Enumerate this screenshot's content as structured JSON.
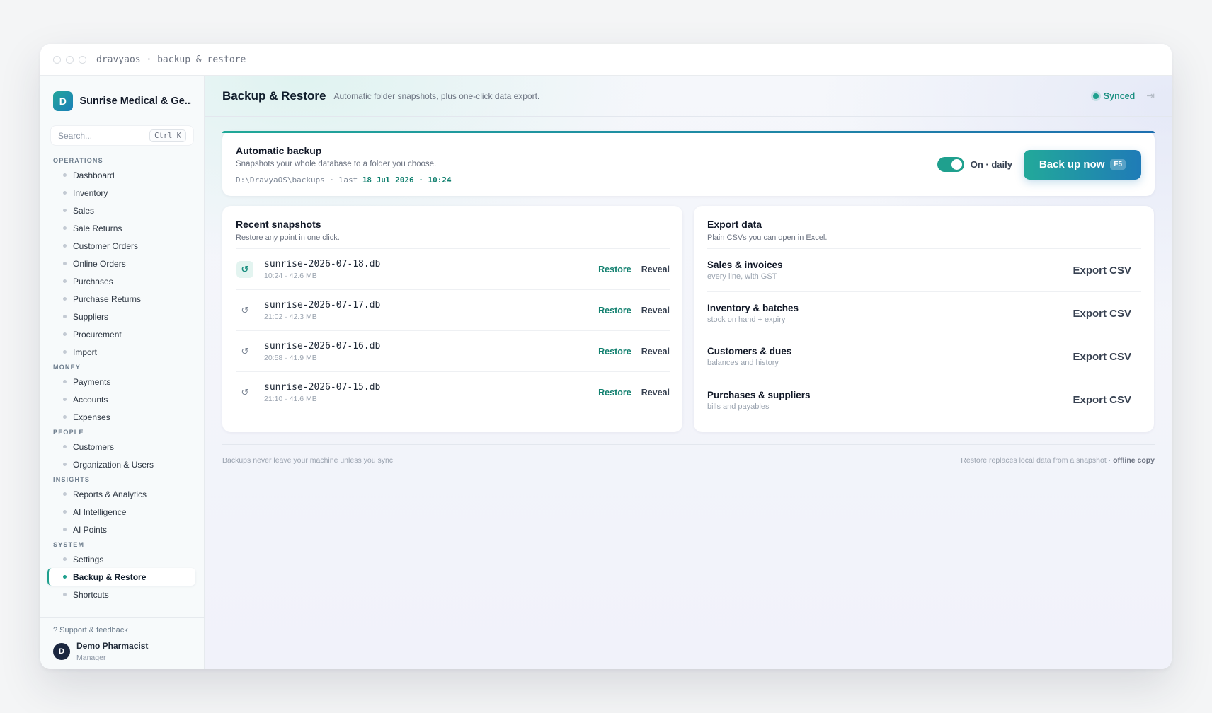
{
  "window": {
    "title": "dravyaos · backup & restore"
  },
  "sidebar": {
    "org_initial": "D",
    "org_name": "Sunrise Medical & Ge...",
    "search_placeholder": "Search...",
    "search_shortcut": "Ctrl K",
    "sections": [
      {
        "label": "OPERATIONS",
        "items": [
          "Dashboard",
          "Inventory",
          "Sales",
          "Sale Returns",
          "Customer Orders",
          "Online Orders",
          "Purchases",
          "Purchase Returns",
          "Suppliers",
          "Procurement",
          "Import"
        ]
      },
      {
        "label": "MONEY",
        "items": [
          "Payments",
          "Accounts",
          "Expenses"
        ]
      },
      {
        "label": "PEOPLE",
        "items": [
          "Customers",
          "Organization & Users"
        ]
      },
      {
        "label": "INSIGHTS",
        "items": [
          "Reports & Analytics",
          "AI Intelligence",
          "AI Points"
        ]
      },
      {
        "label": "SYSTEM",
        "items": [
          "Settings",
          "Backup & Restore",
          "Shortcuts"
        ]
      }
    ],
    "active_item": "Backup & Restore",
    "support": "? Support & feedback",
    "user_initial": "D",
    "user_name": "Demo Pharmacist",
    "user_role": "Manager"
  },
  "header": {
    "title": "Backup & Restore",
    "subtitle": "Automatic folder snapshots, plus one-click data export.",
    "sync_status": "Synced"
  },
  "auto_backup": {
    "title": "Automatic backup",
    "subtitle": "Snapshots your whole database to a folder you choose.",
    "path": "D:\\DravyaOS\\backups · last ",
    "last_time": "18 Jul 2026 · 10:24",
    "toggle_label": "On · daily",
    "toggle_on": true,
    "button_label": "Back up now",
    "button_key": "F5"
  },
  "snapshots": {
    "title": "Recent snapshots",
    "subtitle": "Restore any point in one click.",
    "restore_label": "Restore",
    "reveal_label": "Reveal",
    "items": [
      {
        "name": "sunrise-2026-07-18.db",
        "meta": "10:24 · 42.6 MB"
      },
      {
        "name": "sunrise-2026-07-17.db",
        "meta": "21:02 · 42.3 MB"
      },
      {
        "name": "sunrise-2026-07-16.db",
        "meta": "20:58 · 41.9 MB"
      },
      {
        "name": "sunrise-2026-07-15.db",
        "meta": "21:10 · 41.6 MB"
      }
    ]
  },
  "export": {
    "title": "Export data",
    "subtitle": "Plain CSVs you can open in Excel.",
    "button_label": "Export CSV",
    "items": [
      {
        "title": "Sales & invoices",
        "sub": "every line, with GST"
      },
      {
        "title": "Inventory & batches",
        "sub": "stock on hand + expiry"
      },
      {
        "title": "Customers & dues",
        "sub": "balances and history"
      },
      {
        "title": "Purchases & suppliers",
        "sub": "bills and payables"
      }
    ]
  },
  "footer": {
    "left": "Backups never leave your machine unless you sync",
    "right": "Restore replaces local data from a snapshot · ",
    "right_bold": "offline copy"
  },
  "colors": {
    "accent": "#1fa08e",
    "accent_blue": "#1f7bb7"
  }
}
